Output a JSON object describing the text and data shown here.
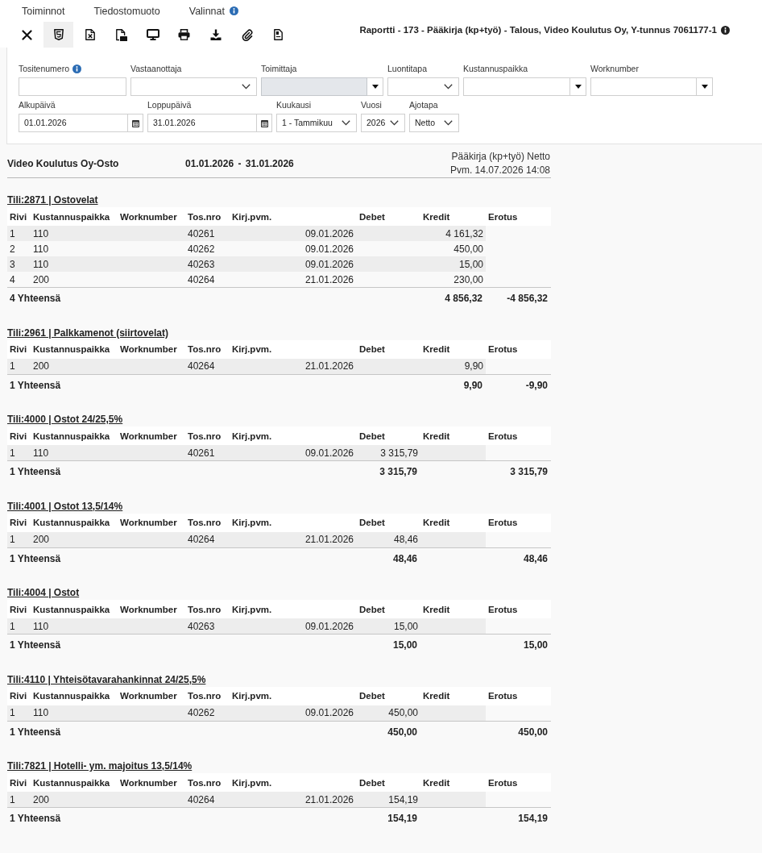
{
  "menu": [
    {
      "label": "Toiminnot",
      "info": false
    },
    {
      "label": "Tiedostomuoto",
      "info": false
    },
    {
      "label": "Valinnat",
      "info": true
    }
  ],
  "toolbar": [
    {
      "kind": "close",
      "selected": false
    },
    {
      "kind": "html",
      "selected": true
    },
    {
      "kind": "excel",
      "selected": false
    },
    {
      "kind": "pdf",
      "selected": false
    },
    {
      "kind": "screen",
      "selected": false
    },
    {
      "kind": "print",
      "selected": false
    },
    {
      "kind": "download",
      "selected": false
    },
    {
      "kind": "attach",
      "selected": false
    },
    {
      "kind": "document",
      "selected": false
    }
  ],
  "report_title": {
    "text": "Raportti - 173 - Pääkirja (kp+työ) - Talous, Video Koulutus Oy, Y-tunnus 7061177-1",
    "info": true
  },
  "filter_rows": [
    {
      "fields": [
        {
          "label": "Tositenumero",
          "info": true,
          "kind": "text",
          "disabled": false
        },
        {
          "label": "Vastaanottaja",
          "info": false,
          "kind": "select",
          "disabled": false
        },
        {
          "label": "Toimittaja",
          "info": false,
          "kind": "combo",
          "disabled": true
        },
        {
          "label": "Luontitapa",
          "info": false,
          "kind": "select",
          "disabled": false
        },
        {
          "label": "Kustannuspaikka",
          "info": false,
          "kind": "combo",
          "disabled": false
        },
        {
          "label": "Worknumber",
          "info": false,
          "kind": "combo",
          "disabled": false
        }
      ]
    },
    {
      "fields": [
        {
          "label": "Alkupäivä",
          "info": false,
          "kind": "date",
          "value": "01.01.2026",
          "disabled": false
        },
        {
          "label": "Loppupäivä",
          "info": false,
          "kind": "date",
          "value": "31.01.2026",
          "disabled": false
        },
        {
          "label": "Kuukausi",
          "info": false,
          "kind": "select",
          "value": "1 - Tammikuu",
          "disabled": false
        },
        {
          "label": "Vuosi",
          "info": false,
          "kind": "select",
          "value": "2026",
          "disabled": false
        },
        {
          "label": "Ajotapa",
          "info": false,
          "kind": "select",
          "value": "Netto",
          "disabled": false
        }
      ]
    }
  ],
  "report_header": {
    "company": "Video Koulutus Oy-Osto",
    "period": "01.01.2026 - 31.01.2026",
    "report_name": "Pääkirja (kp+työ) Netto",
    "printed": "Pvm. 14.07.2026 14:08"
  },
  "accounts": [
    {
      "title": "Tili:2871 | Ostovelat",
      "columns": [
        "Rivi",
        "Kustannuspaikka",
        "Worknumber",
        "Tos.nro",
        "Kirj.pvm.",
        "Debet",
        "Kredit",
        "Erotus"
      ],
      "rows": [
        {
          "rivi": "1",
          "kustannuspaikka": "110",
          "tos_nro": "40261",
          "kirj_pvm": "09.01.2026",
          "kredit": "4 161,32"
        },
        {
          "rivi": "2",
          "kustannuspaikka": "110",
          "tos_nro": "40262",
          "kirj_pvm": "09.01.2026",
          "kredit": "450,00"
        },
        {
          "rivi": "3",
          "kustannuspaikka": "110",
          "tos_nro": "40263",
          "kirj_pvm": "09.01.2026",
          "kredit": "15,00"
        },
        {
          "rivi": "4",
          "kustannuspaikka": "200",
          "tos_nro": "40264",
          "kirj_pvm": "21.01.2026",
          "kredit": "230,00"
        }
      ],
      "total": {
        "label": "4 Yhteensä",
        "kredit": "4 856,32",
        "erotus": "-4 856,32"
      }
    },
    {
      "title": "Tili:2961 | Palkkamenot (siirtovelat)",
      "columns": [
        "Rivi",
        "Kustannuspaikka",
        "Worknumber",
        "Tos.nro",
        "Kirj.pvm.",
        "Debet",
        "Kredit",
        "Erotus"
      ],
      "rows": [
        {
          "rivi": "1",
          "kustannuspaikka": "200",
          "tos_nro": "40264",
          "kirj_pvm": "21.01.2026",
          "kredit": "9,90"
        }
      ],
      "total": {
        "label": "1 Yhteensä",
        "kredit": "9,90",
        "erotus": "-9,90"
      }
    },
    {
      "title": "Tili:4000 | Ostot 24/25,5%",
      "columns": [
        "Rivi",
        "Kustannuspaikka",
        "Worknumber",
        "Tos.nro",
        "Kirj.pvm.",
        "Debet",
        "Kredit",
        "Erotus"
      ],
      "rows": [
        {
          "rivi": "1",
          "kustannuspaikka": "110",
          "tos_nro": "40261",
          "kirj_pvm": "09.01.2026",
          "debet": "3 315,79"
        }
      ],
      "total": {
        "label": "1 Yhteensä",
        "debet": "3 315,79",
        "erotus": "3 315,79"
      }
    },
    {
      "title": "Tili:4001 | Ostot 13,5/14%",
      "columns": [
        "Rivi",
        "Kustannuspaikka",
        "Worknumber",
        "Tos.nro",
        "Kirj.pvm.",
        "Debet",
        "Kredit",
        "Erotus"
      ],
      "rows": [
        {
          "rivi": "1",
          "kustannuspaikka": "200",
          "tos_nro": "40264",
          "kirj_pvm": "21.01.2026",
          "debet": "48,46"
        }
      ],
      "total": {
        "label": "1 Yhteensä",
        "debet": "48,46",
        "erotus": "48,46"
      }
    },
    {
      "title": "Tili:4004 | Ostot",
      "columns": [
        "Rivi",
        "Kustannuspaikka",
        "Worknumber",
        "Tos.nro",
        "Kirj.pvm.",
        "Debet",
        "Kredit",
        "Erotus"
      ],
      "rows": [
        {
          "rivi": "1",
          "kustannuspaikka": "110",
          "tos_nro": "40263",
          "kirj_pvm": "09.01.2026",
          "debet": "15,00"
        }
      ],
      "total": {
        "label": "1 Yhteensä",
        "debet": "15,00",
        "erotus": "15,00"
      }
    },
    {
      "title": "Tili:4110 | Yhteisötavarahankinnat 24/25,5%",
      "columns": [
        "Rivi",
        "Kustannuspaikka",
        "Worknumber",
        "Tos.nro",
        "Kirj.pvm.",
        "Debet",
        "Kredit",
        "Erotus"
      ],
      "rows": [
        {
          "rivi": "1",
          "kustannuspaikka": "110",
          "tos_nro": "40262",
          "kirj_pvm": "09.01.2026",
          "debet": "450,00"
        }
      ],
      "total": {
        "label": "1 Yhteensä",
        "debet": "450,00",
        "erotus": "450,00"
      }
    },
    {
      "title": "Tili:7821 | Hotelli- ym. majoitus 13,5/14%",
      "columns": [
        "Rivi",
        "Kustannuspaikka",
        "Worknumber",
        "Tos.nro",
        "Kirj.pvm.",
        "Debet",
        "Kredit",
        "Erotus"
      ],
      "rows": [
        {
          "rivi": "1",
          "kustannuspaikka": "200",
          "tos_nro": "40264",
          "kirj_pvm": "21.01.2026",
          "debet": "154,19"
        }
      ],
      "total": {
        "label": "1 Yhteensä",
        "debet": "154,19",
        "erotus": "154,19"
      }
    }
  ]
}
